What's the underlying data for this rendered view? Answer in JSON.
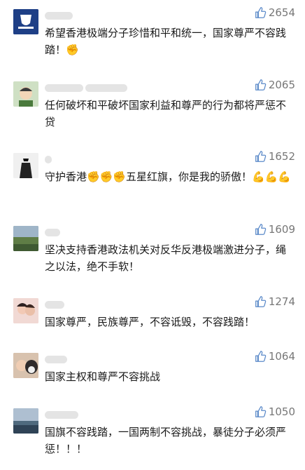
{
  "comments": [
    {
      "likes": "2654",
      "text": "希望香港极端分子珍惜和平和统一，国家尊严不容践踏！",
      "emoji": "✊",
      "avatar": "badge"
    },
    {
      "likes": "2065",
      "text": "任何破坏和平破坏国家利益和尊严的行为都将严惩不贷",
      "emoji": "",
      "avatar": "cartoon"
    },
    {
      "likes": "1652",
      "text": "守护香港✊✊✊五星红旗，你是我的骄傲！💪💪💪",
      "emoji": "",
      "avatar": "bw"
    },
    {
      "likes": "1609",
      "text": "坚决支持香港政法机关对反华反港极端激进分子，绳之以法，绝不手软！",
      "emoji": "",
      "avatar": "landscape"
    },
    {
      "likes": "1274",
      "text": "国家尊严，民族尊严，不容诋毁，不容践踏！",
      "emoji": "",
      "avatar": "photo"
    },
    {
      "likes": "1064",
      "text": "国家主权和尊严不容挑战",
      "emoji": "",
      "avatar": "dog"
    },
    {
      "likes": "1050",
      "text": "国旗不容践踏，一国两制不容挑战，暴徒分子必须严惩！！！",
      "emoji": "",
      "avatar": "sky"
    }
  ]
}
